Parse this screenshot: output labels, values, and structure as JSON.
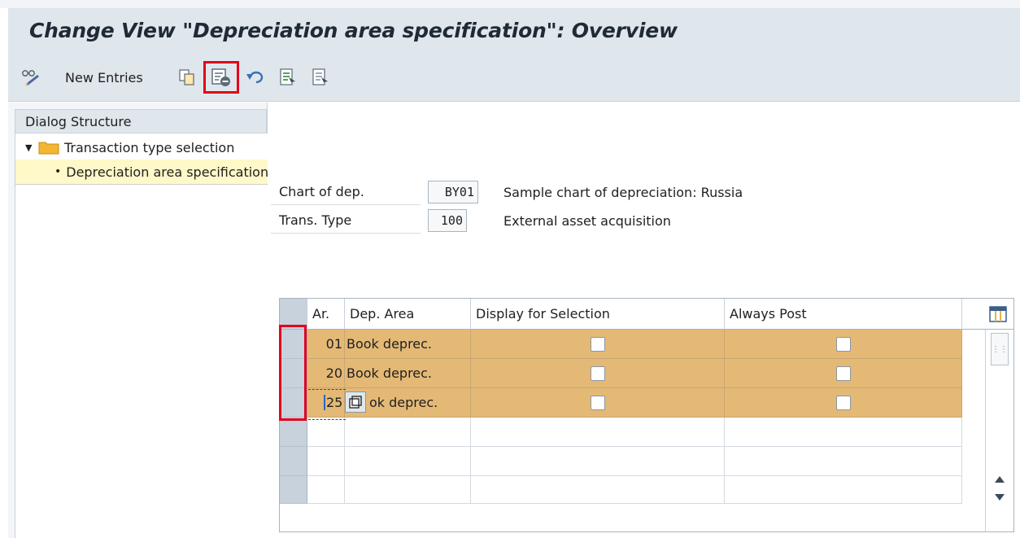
{
  "window": {
    "title": "Change View \"Depreciation area specification\": Overview"
  },
  "toolbar": {
    "new_entries_label": "New Entries"
  },
  "dialog_structure": {
    "header": "Dialog Structure",
    "items": [
      {
        "label": "Transaction type selection",
        "expanded": true
      },
      {
        "label": "Depreciation area specification",
        "selected": true
      }
    ]
  },
  "fields": {
    "chart_of_dep": {
      "label": "Chart of dep.",
      "value": "BY01",
      "description": "Sample chart of depreciation: Russia"
    },
    "trans_type": {
      "label": "Trans. Type",
      "value": "100",
      "description": "External asset acquisition"
    }
  },
  "table": {
    "columns": [
      "Ar.",
      "Dep. Area",
      "Display for Selection",
      "Always Post"
    ],
    "rows": [
      {
        "area": "01",
        "dep_area": "Book deprec.",
        "display_for_selection": false,
        "always_post": false
      },
      {
        "area": "20",
        "dep_area": "Book deprec.",
        "display_for_selection": false,
        "always_post": false
      },
      {
        "area": "25",
        "dep_area": "ok deprec.",
        "display_for_selection": false,
        "always_post": false
      }
    ],
    "empty_rows": 3
  },
  "colors": {
    "header_bg": "#dfe6ec",
    "row_highlight": "#e4b976",
    "selected_tree_row": "#fff8c8",
    "annotation_red": "#e3001b"
  },
  "icons": [
    "glasses-pencil-icon",
    "copy-icon",
    "delete-icon",
    "undo-icon",
    "select-all-icon",
    "deselect-all-icon",
    "table-settings-icon",
    "scroll-up-icon",
    "scroll-down-icon"
  ]
}
